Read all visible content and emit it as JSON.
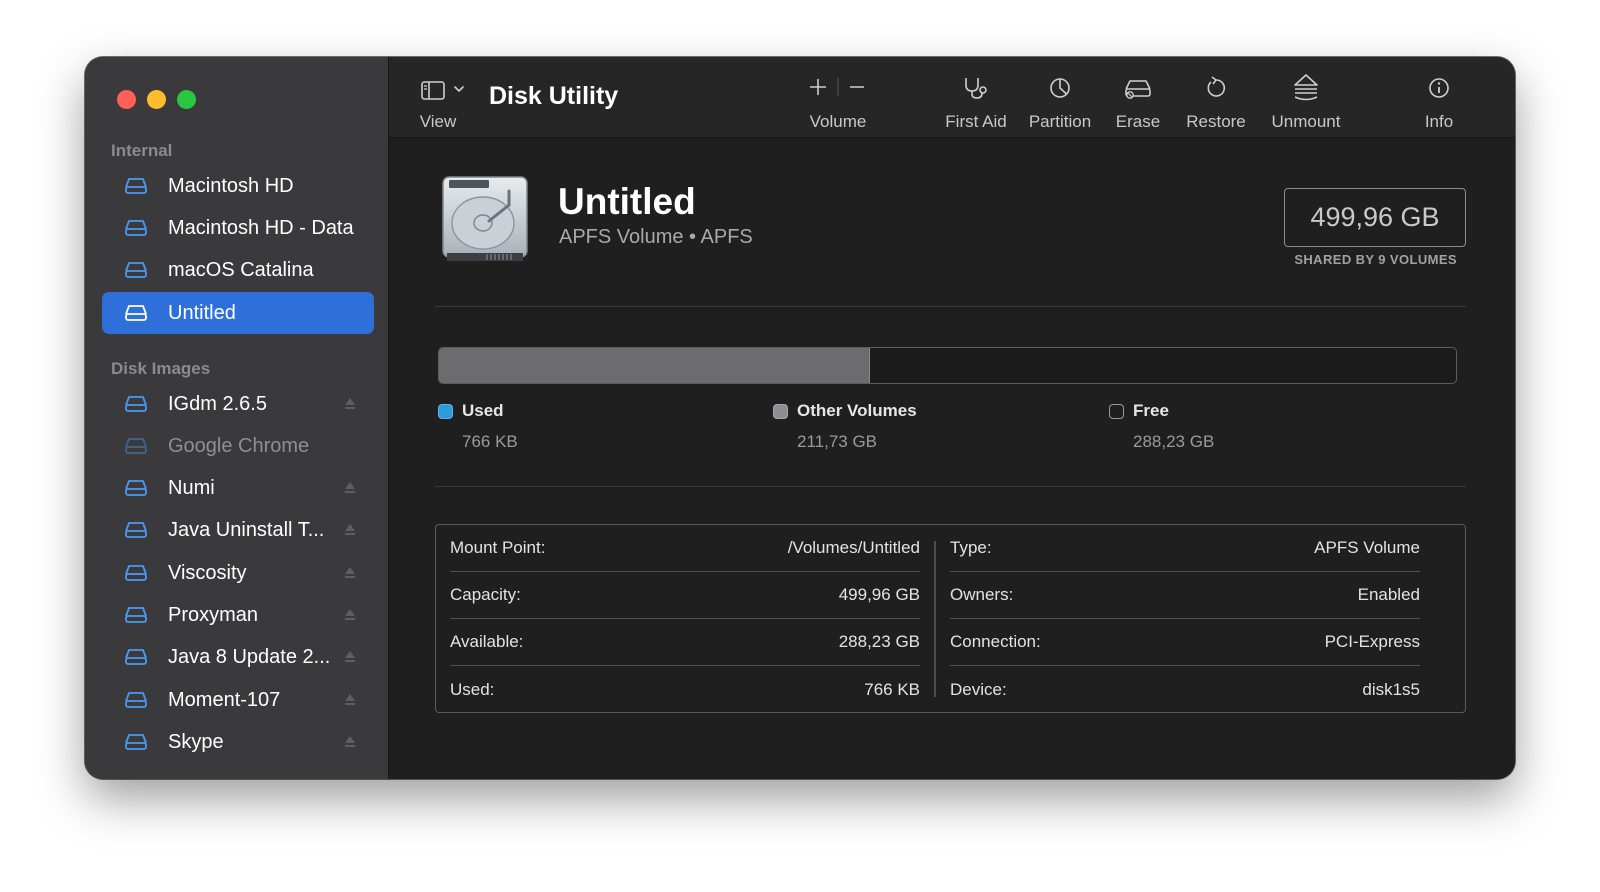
{
  "sidebar": {
    "sections": {
      "internal": "Internal",
      "disk_images": "Disk Images"
    },
    "internal_items": [
      {
        "label": "Macintosh HD",
        "icon": "internal-drive-icon"
      },
      {
        "label": "Macintosh HD - Data",
        "icon": "internal-drive-icon"
      },
      {
        "label": "macOS Catalina",
        "icon": "internal-drive-icon"
      },
      {
        "label": "Untitled",
        "icon": "internal-drive-icon",
        "selected": true
      }
    ],
    "image_items": [
      {
        "label": "IGdm 2.6.5",
        "icon": "disk-image-icon"
      },
      {
        "label": "Google Chrome",
        "icon": "disk-image-icon",
        "dimmed": true
      },
      {
        "label": "Numi",
        "icon": "disk-image-icon"
      },
      {
        "label": "Java Uninstall T...",
        "icon": "disk-image-icon"
      },
      {
        "label": "Viscosity",
        "icon": "disk-image-icon"
      },
      {
        "label": "Proxyman",
        "icon": "disk-image-icon"
      },
      {
        "label": "Java 8 Update 2...",
        "icon": "disk-image-icon"
      },
      {
        "label": "Moment-107",
        "icon": "disk-image-icon"
      },
      {
        "label": "Skype",
        "icon": "disk-image-icon"
      }
    ]
  },
  "toolbar": {
    "view_label": "View",
    "title": "Disk Utility",
    "volume_label": "Volume",
    "first_aid_label": "First Aid",
    "partition_label": "Partition",
    "erase_label": "Erase",
    "restore_label": "Restore",
    "unmount_label": "Unmount",
    "info_label": "Info"
  },
  "volume": {
    "name": "Untitled",
    "subtitle": "APFS Volume • APFS",
    "capacity": "499,96 GB",
    "shared_note": "SHARED BY 9 VOLUMES"
  },
  "usage": {
    "used": {
      "label": "Used",
      "value": "766 KB",
      "color": "#2d9bd7"
    },
    "other": {
      "label": "Other Volumes",
      "value": "211,73 GB",
      "color": "#8e8e90"
    },
    "free": {
      "label": "Free",
      "value": "288,23 GB",
      "color": "#1f1f1f"
    },
    "other_fraction": 0.4235
  },
  "info": {
    "left": [
      {
        "label": "Mount Point:",
        "value": "/Volumes/Untitled"
      },
      {
        "label": "Capacity:",
        "value": "499,96 GB"
      },
      {
        "label": "Available:",
        "value": "288,23 GB"
      },
      {
        "label": "Used:",
        "value": "766 KB"
      }
    ],
    "right": [
      {
        "label": "Type:",
        "value": "APFS Volume"
      },
      {
        "label": "Owners:",
        "value": "Enabled"
      },
      {
        "label": "Connection:",
        "value": "PCI-Express"
      },
      {
        "label": "Device:",
        "value": "disk1s5"
      }
    ]
  }
}
